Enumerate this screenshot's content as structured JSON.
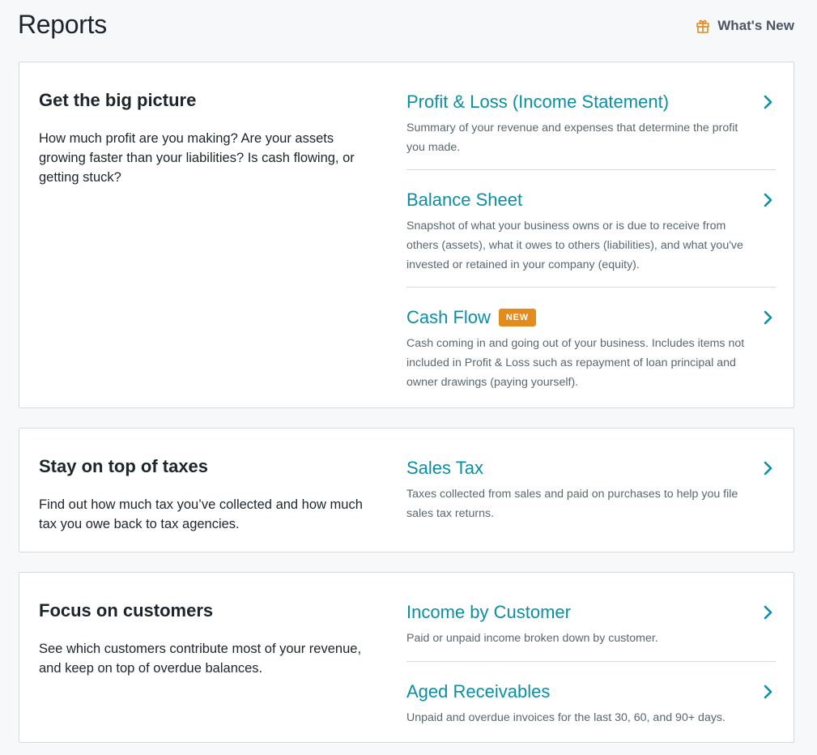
{
  "header": {
    "title": "Reports",
    "whats_new_label": "What's New",
    "accent_color": "#e28c1e"
  },
  "sections": [
    {
      "heading": "Get the big picture",
      "description": "How much profit are you making? Are your assets growing faster than your liabilities? Is cash flowing, or getting stuck?",
      "reports": [
        {
          "title": "Profit & Loss (Income Statement)",
          "description": "Summary of your revenue and expenses that determine the profit you made."
        },
        {
          "title": "Balance Sheet",
          "description": "Snapshot of what your business owns or is due to receive from others (assets), what it owes to others (liabilities), and what you've invested or retained in your company (equity)."
        },
        {
          "title": "Cash Flow",
          "badge": "NEW",
          "description": "Cash coming in and going out of your business. Includes items not included in Profit & Loss such as repayment of loan principal and owner drawings (paying yourself)."
        }
      ]
    },
    {
      "heading": "Stay on top of taxes",
      "description": "Find out how much tax you’ve collected and how much tax you owe back to tax agencies.",
      "reports": [
        {
          "title": "Sales Tax",
          "description": "Taxes collected from sales and paid on purchases to help you file sales tax returns."
        }
      ]
    },
    {
      "heading": "Focus on customers",
      "description": "See which customers contribute most of your revenue, and keep on top of overdue balances.",
      "reports": [
        {
          "title": "Income by Customer",
          "description": "Paid or unpaid income broken down by customer."
        },
        {
          "title": "Aged Receivables",
          "description": "Unpaid and overdue invoices for the last 30, 60, and 90+ days."
        }
      ]
    }
  ],
  "colors": {
    "link": "#0a8fa3",
    "badge": "#e28c1e",
    "border": "#d4dae0",
    "background": "#f7f8fa"
  }
}
